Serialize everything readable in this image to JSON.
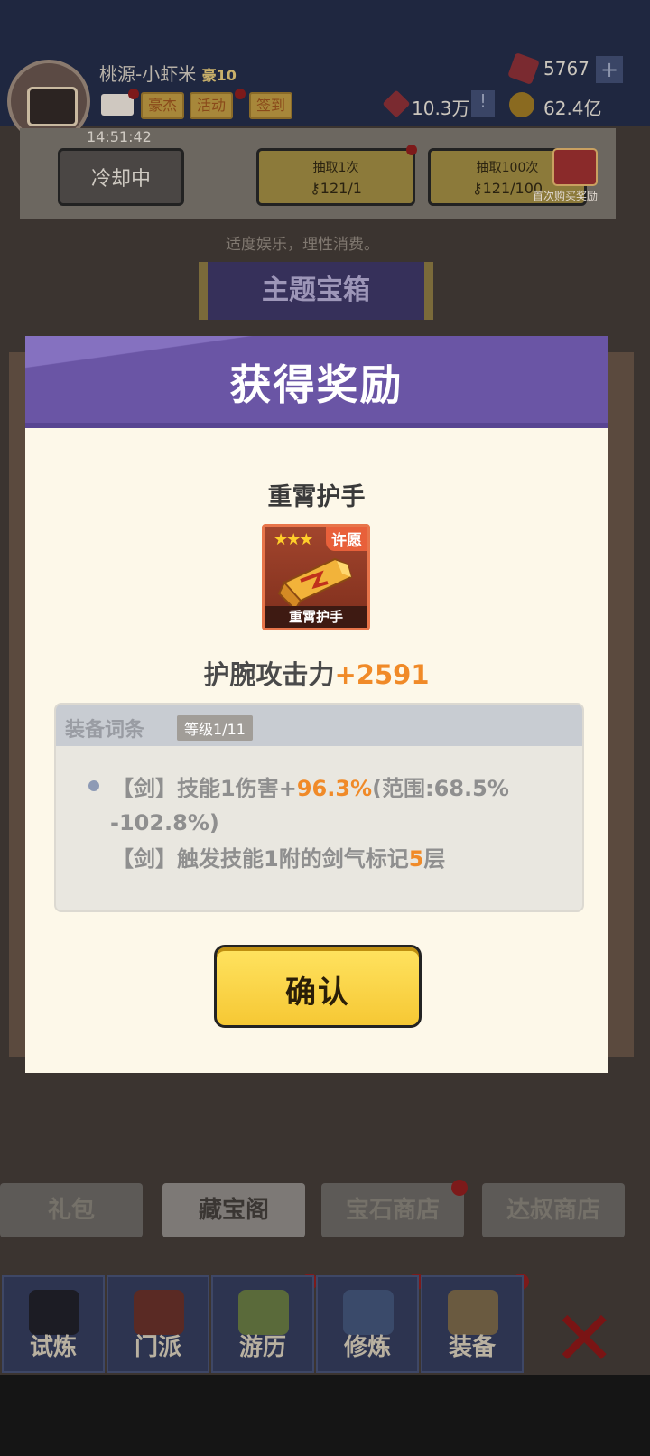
{
  "player": {
    "name": "桃源-小虾米",
    "vip": "豪10",
    "timer": "14:51:42"
  },
  "resources": {
    "gems": "5767",
    "power": "10.3万",
    "gold": "62.4亿"
  },
  "tags": [
    "豪杰",
    "活动",
    "签到"
  ],
  "draw": {
    "cooldown_label": "冷却中",
    "once_label": "抽取1次",
    "once_keys": "121/1",
    "hundred_label": "抽取100次",
    "hundred_keys": "121/100",
    "first_buy": "首次购买奖励"
  },
  "hint": "适度娱乐，理性消费。",
  "banner": "主题宝箱",
  "shop_tabs": [
    "礼包",
    "藏宝阁",
    "宝石商店",
    "达叔商店"
  ],
  "nav": [
    "试炼",
    "门派",
    "游历",
    "修炼",
    "装备"
  ],
  "modal": {
    "title": "获得奖励",
    "item_name": "重霄护手",
    "item_label": "重霄护手",
    "wish_tag": "许愿",
    "stars": "★★★",
    "attack_label": "护腕攻击力",
    "attack_value": "+2591",
    "affix_title": "装备词条",
    "affix_level": "等级1/11",
    "affix1_a": "【剑】技能1伤害+",
    "affix1_hl": "96.3%",
    "affix1_b": "(范围:68.5%",
    "affix1_c": "-102.8%)",
    "affix2_a": "【剑】触发技能1附的剑气标记",
    "affix2_hl": "5",
    "affix2_b": "层",
    "confirm": "确认"
  },
  "colors": {
    "accent_purple": "#6a55a5",
    "highlight": "#f08a28",
    "confirm_yellow": "#f6c834"
  }
}
